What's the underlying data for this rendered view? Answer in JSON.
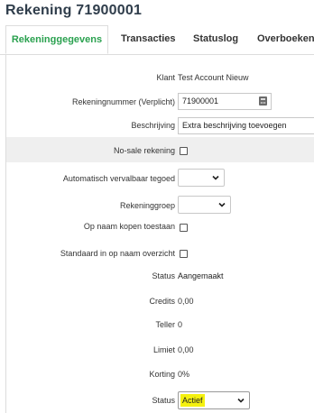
{
  "page": {
    "title": "Rekening 71900001"
  },
  "tabs": [
    {
      "label": "Rekeninggegevens",
      "active": true
    },
    {
      "label": "Transacties",
      "active": false
    },
    {
      "label": "Statuslog",
      "active": false
    },
    {
      "label": "Overboeken",
      "active": false
    }
  ],
  "form": {
    "klant": {
      "label": "Klant",
      "value": "Test Account Nieuw"
    },
    "rekeningnummer": {
      "label": "Rekeningnummer (Verplicht)",
      "value": "71900001",
      "icon": "calculator-icon"
    },
    "beschrijving": {
      "label": "Beschrijving",
      "value": "Extra beschrijving toevoegen"
    },
    "no_sale": {
      "label": "No-sale rekening",
      "checked": false
    },
    "vervalbaar": {
      "label": "Automatisch vervalbaar tegoed",
      "value": ""
    },
    "rekeninggroep": {
      "label": "Rekeninggroep",
      "value": ""
    },
    "op_naam_kopen": {
      "label": "Op naam kopen toestaan",
      "checked": false
    },
    "standaard_overzicht": {
      "label": "Standaard in op naam overzicht",
      "checked": false
    },
    "status_readonly": {
      "label": "Status",
      "value": "Aangemaakt"
    },
    "credits": {
      "label": "Credits",
      "value": "0,00"
    },
    "teller": {
      "label": "Teller",
      "value": "0"
    },
    "limiet": {
      "label": "Limiet",
      "value": "0,00"
    },
    "korting": {
      "label": "Korting",
      "value": "0%"
    },
    "status_select": {
      "label": "Status",
      "value": "Actief",
      "highlight_color": "#f5f10f"
    }
  },
  "colors": {
    "accent": "#2aa14f",
    "title": "#2f3d4b",
    "shaded_row": "#efefef"
  }
}
